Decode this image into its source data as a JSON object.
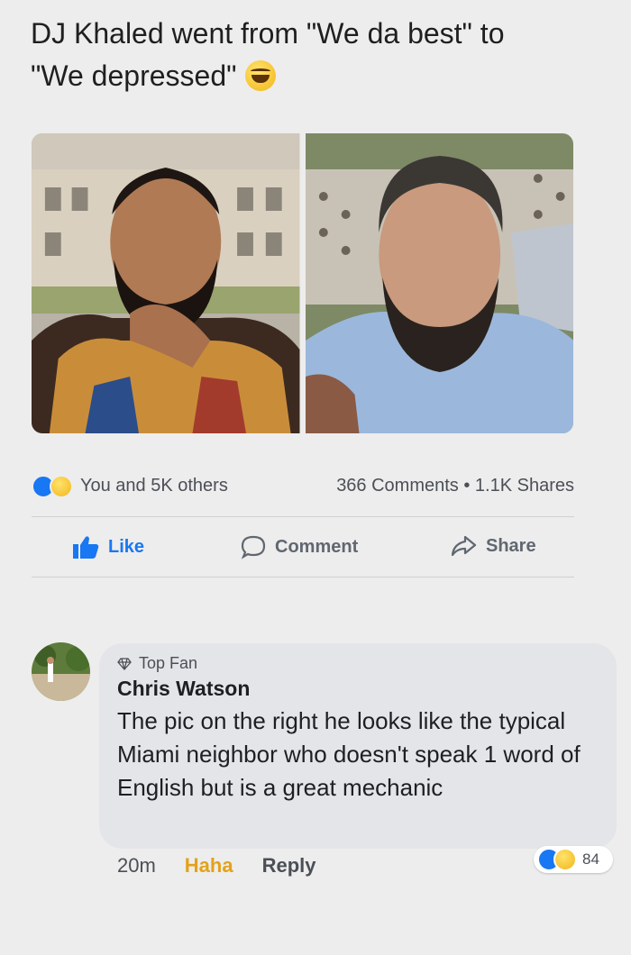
{
  "post": {
    "text_line1": "DJ Khaled went from \"We da best\" to",
    "text_line2": "\"We depressed\"",
    "emoji": "laughing-tears-emoji"
  },
  "stats": {
    "reactors": "You and 5K others",
    "comments_shares": "366 Comments • 1.1K Shares"
  },
  "actions": {
    "like": "Like",
    "comment": "Comment",
    "share": "Share"
  },
  "comment": {
    "badge": "Top Fan",
    "author": "Chris Watson",
    "text": "The pic on the right he looks like the typical Miami neighbor who doesn't speak 1 word of English but is a great mechanic",
    "time": "20m",
    "reaction_given": "Haha",
    "reply": "Reply",
    "reaction_count": "84"
  },
  "colors": {
    "like_blue": "#1877f2",
    "haha_yellow": "#e3a21a",
    "background": "#ededed",
    "bubble": "#e4e5e8"
  }
}
